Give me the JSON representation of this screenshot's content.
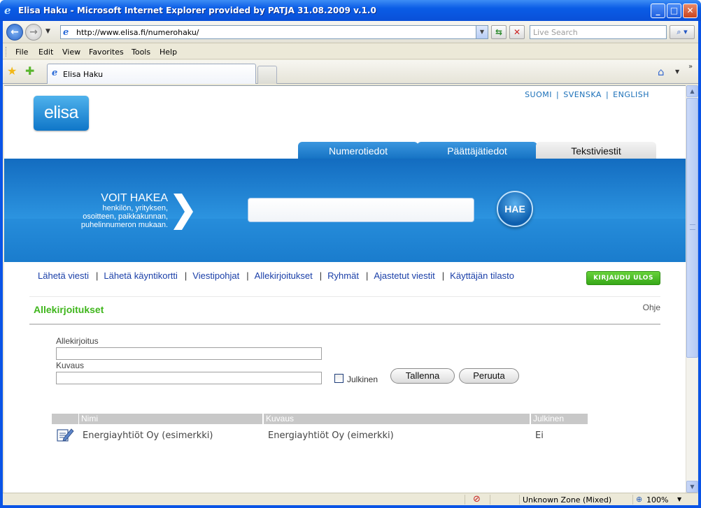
{
  "window": {
    "title": "Elisa Haku - Microsoft Internet Explorer provided by PATJA 31.08.2009 v.1.0",
    "minimize": "_",
    "maximize": "□",
    "close": "✕"
  },
  "address_bar": {
    "url": "http://www.elisa.fi/numerohaku/",
    "search_placeholder": "Live Search"
  },
  "menu": [
    {
      "label": "File"
    },
    {
      "label": "Edit"
    },
    {
      "label": "View"
    },
    {
      "label": "Favorites"
    },
    {
      "label": "Tools"
    },
    {
      "label": "Help"
    }
  ],
  "browser_tab": {
    "label": "Elisa Haku"
  },
  "status_bar": {
    "zone": "Unknown Zone (Mixed)",
    "zoom": "100%"
  },
  "page": {
    "languages": [
      "SUOMI",
      "SVENSKA",
      "ENGLISH"
    ],
    "logo_text": "elisa",
    "site_tabs": [
      "Numerotiedot",
      "Päättäjätiedot",
      "Tekstiviestit"
    ],
    "banner": {
      "headline": "VOIT HAKEA",
      "lines": [
        "henkilön, yrityksen,",
        "osoitteen, paikkakunnan,",
        "puhelinnumeron mukaan."
      ],
      "search_button": "HAE"
    },
    "subnav": [
      "Lähetä viesti",
      "Lähetä käyntikortti",
      "Viestipohjat",
      "Allekirjoitukset",
      "Ryhmät",
      "Ajastetut viestit",
      "Käyttäjän tilasto"
    ],
    "logout": "KIRJAUDU ULOS",
    "section": {
      "title": "Allekirjoitukset",
      "help": "Ohje"
    },
    "form": {
      "signature_label": "Allekirjoitus",
      "signature_value": "",
      "description_label": "Kuvaus",
      "description_value": "",
      "public_label": "Julkinen",
      "save": "Tallenna",
      "cancel": "Peruuta"
    },
    "table": {
      "headers": [
        "Nimi",
        "Kuvaus",
        "Julkinen"
      ],
      "rows": [
        {
          "name": "Energiayhtiöt Oy (esimerkki)",
          "description": "Energiayhtiöt Oy (eimerkki)",
          "public": "Ei"
        }
      ]
    }
  }
}
